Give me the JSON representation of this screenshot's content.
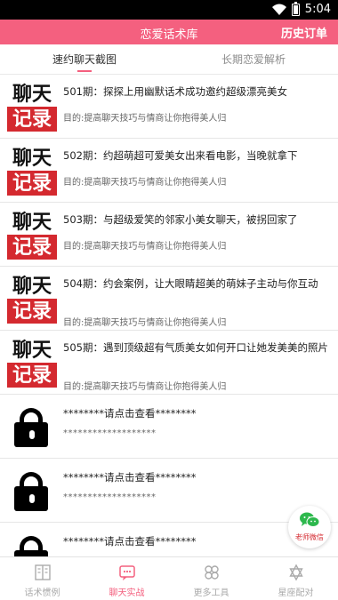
{
  "status_bar": {
    "time": "5:04"
  },
  "app_bar": {
    "title": "恋爱话术库",
    "right_action": "历史订单"
  },
  "tabs": [
    {
      "label": "速约聊天截图",
      "active": true
    },
    {
      "label": "长期恋爱解析",
      "active": false
    }
  ],
  "thumb": {
    "top_text": "聊天",
    "bottom_text": "记录"
  },
  "items": [
    {
      "title": "501期：探探上用幽默话术成功邀约超级漂亮美女",
      "subtitle": "目的:提高聊天技巧与情商让你抱得美人归",
      "locked": false
    },
    {
      "title": "502期：约超萌超可爱美女出来看电影，当晚就拿下",
      "subtitle": "目的:提高聊天技巧与情商让你抱得美人归",
      "locked": false
    },
    {
      "title": "503期：与超级爱笑的邻家小美女聊天，被拐回家了",
      "subtitle": "目的:提高聊天技巧与情商让你抱得美人归",
      "locked": false
    },
    {
      "title": "504期：约会案例，让大眼睛超美的萌妹子主动与你互动",
      "subtitle": "目的:提高聊天技巧与情商让你抱得美人归",
      "locked": false
    },
    {
      "title": "505期：遇到顶级超有气质美女如何开口让她发美美的照片",
      "subtitle": "目的:提高聊天技巧与情商让你抱得美人归",
      "locked": false
    },
    {
      "title": "********请点击查看********",
      "subtitle": "*******************",
      "locked": true
    },
    {
      "title": "********请点击查看********",
      "subtitle": "*******************",
      "locked": true
    },
    {
      "title": "********请点击查看********",
      "subtitle": "",
      "locked": true
    }
  ],
  "floating": {
    "label": "老师微信"
  },
  "bottom_nav": [
    {
      "label": "话术惯例",
      "icon": "book-icon",
      "active": false
    },
    {
      "label": "聊天实战",
      "icon": "chat-icon",
      "active": true
    },
    {
      "label": "更多工具",
      "icon": "grid-icon",
      "active": false
    },
    {
      "label": "星座配对",
      "icon": "star-icon",
      "active": false
    }
  ],
  "colors": {
    "primary": "#f4607f",
    "active_nav": "#f4607f",
    "thumb_red": "#d4292f"
  }
}
